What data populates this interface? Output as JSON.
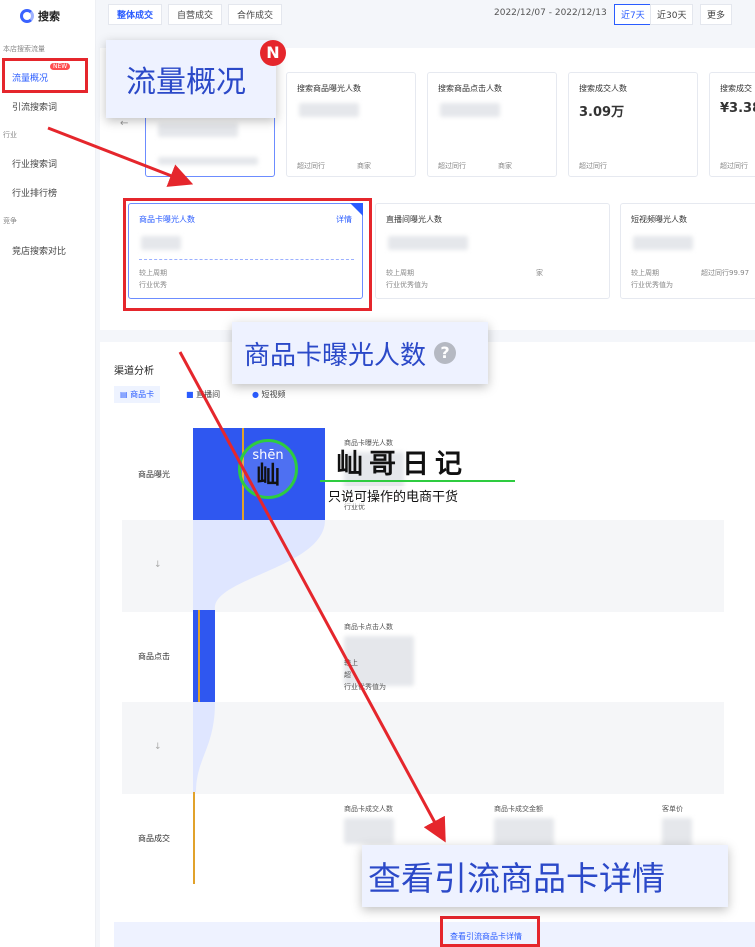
{
  "sidebar": {
    "logo": "搜索",
    "sections": [
      {
        "title": "本店搜索流量",
        "items": [
          {
            "label": "流量概况",
            "badge": "NEW",
            "active": true
          },
          {
            "label": "引流搜索词"
          }
        ]
      },
      {
        "title": "行业",
        "items": [
          {
            "label": "行业搜索词"
          },
          {
            "label": "行业排行榜"
          }
        ]
      },
      {
        "title": "竞争",
        "items": [
          {
            "label": "竞店搜索对比"
          }
        ]
      }
    ]
  },
  "toolbar": {
    "tabs": [
      "整体成交",
      "自营成交",
      "合作成交"
    ],
    "date_range": "2022/12/07 - 2022/12/13",
    "date_tabs": [
      "近7天",
      "近30天",
      "更多"
    ]
  },
  "metric_cards": [
    {
      "title": "搜索商品曝光人数",
      "footer": "超过同行",
      "footer2": "商家"
    },
    {
      "title": "搜索商品点击人数",
      "footer": "超过同行",
      "footer2": "商家"
    },
    {
      "title": "搜索成交人数",
      "value": "3.09万",
      "footer": "超过同行"
    },
    {
      "title": "搜索成交",
      "value": "¥3.38",
      "footer": "超过同行"
    }
  ],
  "sub_cards": [
    {
      "title": "商品卡曝光人数",
      "detail": "详情",
      "line1": "较上周期",
      "line2": "行业优秀"
    },
    {
      "title": "直播间曝光人数",
      "line1": "较上周期",
      "line2": "行业优秀值为",
      "tail": "家"
    },
    {
      "title": "短视频曝光人数",
      "line1": "较上周期",
      "line2": "行业优秀值为",
      "tail": "超过同行99.97"
    }
  ],
  "callouts": {
    "traffic": "流量概况",
    "card_exposure": "商品卡曝光人数",
    "view_details": "查看引流商品卡详情",
    "corner": "N"
  },
  "channel": {
    "title": "渠道分析",
    "tabs": [
      "商品卡",
      "直播间",
      "短视频"
    ],
    "rows": [
      {
        "label": "商品曝光",
        "metric": "商品卡曝光人数",
        "sub": "行业优"
      },
      {
        "label": "商品点击",
        "metric": "商品卡点击人数",
        "sub1": "较上",
        "sub2": "超",
        "sub3": "行业优秀值为"
      },
      {
        "label": "商品成交",
        "metrics": [
          "商品卡成交人数",
          "商品卡成交金额",
          "客单价"
        ]
      }
    ],
    "down_arrow": "↓",
    "footer_link": "查看引流商品卡详情"
  },
  "watermark": {
    "pinyin": "shēn",
    "glyph": "屾",
    "name": "屾哥日记",
    "tagline": "只说可操作的电商干货"
  },
  "colors": {
    "accent": "#2a5cff",
    "red": "#e5262c",
    "bar": "#2f57f0",
    "orange": "#e1a22b"
  }
}
